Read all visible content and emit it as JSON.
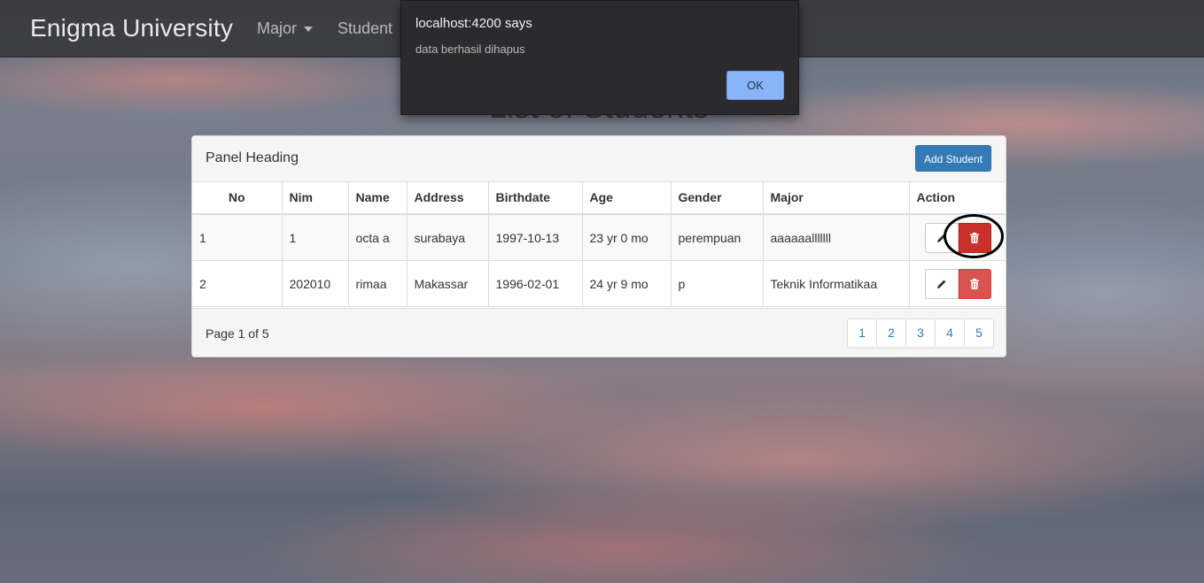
{
  "navbar": {
    "brand": "Enigma University",
    "items": [
      {
        "label": "Major"
      },
      {
        "label": "Student"
      }
    ]
  },
  "page": {
    "title": "List of Students"
  },
  "panel": {
    "heading": "Panel Heading",
    "add_button": "Add Student",
    "columns": [
      "No",
      "Nim",
      "Name",
      "Address",
      "Birthdate",
      "Age",
      "Gender",
      "Major",
      "Action"
    ],
    "rows": [
      {
        "no": "1",
        "nim": "1",
        "name": "octa a",
        "address": "surabaya",
        "birthdate": "1997-10-13",
        "age": "23 yr 0 mo",
        "gender": "perempuan",
        "major": "aaaaaalllllll"
      },
      {
        "no": "2",
        "nim": "202010",
        "name": "rimaa",
        "address": "Makassar",
        "birthdate": "1996-02-01",
        "age": "24 yr 9 mo",
        "gender": "p",
        "major": "Teknik Informatikaa"
      }
    ],
    "footer": {
      "page_info": "Page 1 of 5",
      "pages": [
        "1",
        "2",
        "3",
        "4",
        "5"
      ]
    }
  },
  "dialog": {
    "origin": "localhost:4200 says",
    "message": "data berhasil dihapus",
    "ok_label": "OK"
  },
  "icons": {
    "edit": "pencil-icon",
    "delete": "trash-icon"
  },
  "colors": {
    "primary": "#337ab7",
    "danger": "#d9534f",
    "dialog_button": "#8ab4f8"
  }
}
